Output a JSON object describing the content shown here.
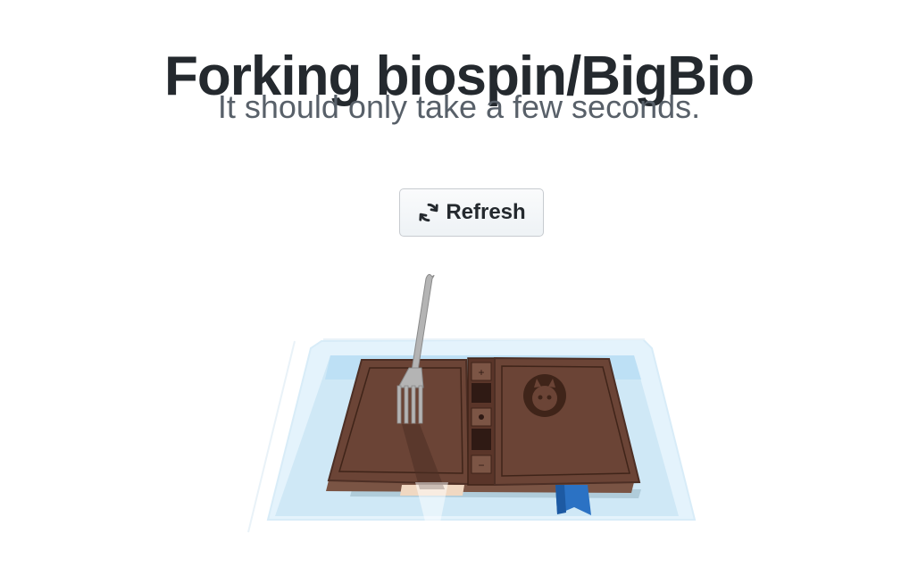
{
  "page": {
    "title": "Forking biospin/BigBio",
    "subtitle": "It should only take a few seconds."
  },
  "actions": {
    "refresh_label": "Refresh",
    "refresh_icon": "sync-icon"
  },
  "illustration": {
    "description_icon": "fork-book-icon",
    "colors": {
      "book": "#6b4436",
      "water": "#bde0f5",
      "bookmark": "#2b72c4",
      "fork": "#a9a9a9"
    }
  }
}
